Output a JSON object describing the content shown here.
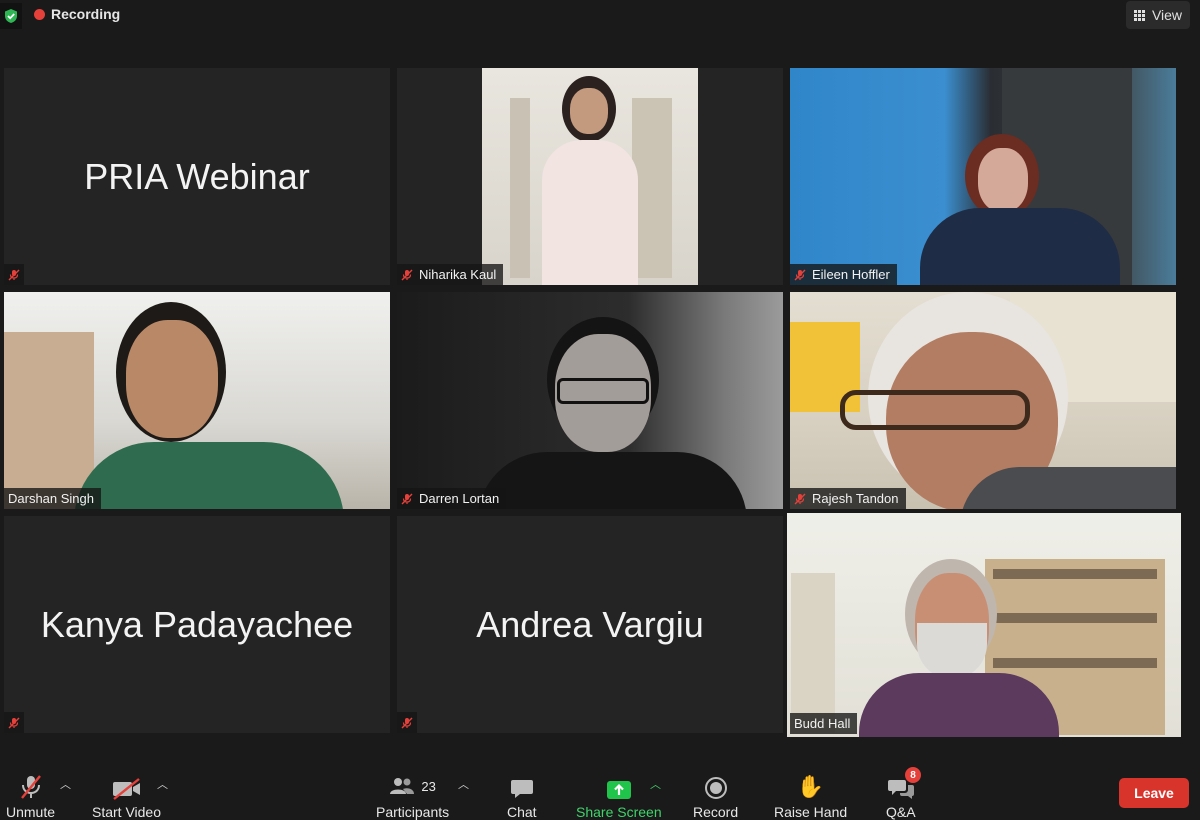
{
  "topbar": {
    "recording_label": "Recording",
    "view_label": "View",
    "icons": [
      "shield-check-icon",
      "recording-dot-icon",
      "grid-view-icon"
    ]
  },
  "tiles": [
    {
      "name": "PRIA Webinar",
      "video": false,
      "muted": true
    },
    {
      "name": "Niharika Kaul",
      "video": true,
      "muted": true
    },
    {
      "name": "Eileen Hoffler",
      "video": true,
      "muted": true
    },
    {
      "name": "Darshan Singh",
      "video": true,
      "muted": false
    },
    {
      "name": "Darren Lortan",
      "video": true,
      "muted": true
    },
    {
      "name": "Rajesh Tandon",
      "video": true,
      "muted": true
    },
    {
      "name": "Kanya Padayachee",
      "video": false,
      "muted": true
    },
    {
      "name": "Andrea Vargiu",
      "video": false,
      "muted": true
    },
    {
      "name": "Budd Hall",
      "video": true,
      "muted": false,
      "active_speaker": true
    }
  ],
  "toolbar": {
    "unmute": "Unmute",
    "start_video": "Start Video",
    "participants": "Participants",
    "participants_count": "23",
    "chat": "Chat",
    "share_screen": "Share Screen",
    "record": "Record",
    "raise_hand": "Raise Hand",
    "qa": "Q&A",
    "qa_badge": "8",
    "leave": "Leave"
  },
  "colors": {
    "background": "#1a1a1a",
    "tile": "#242424",
    "recording_dot": "#e5403a",
    "share_green": "#21c44a",
    "active_speaker_border": "#d7e23e",
    "leave_red": "#d8342b"
  }
}
